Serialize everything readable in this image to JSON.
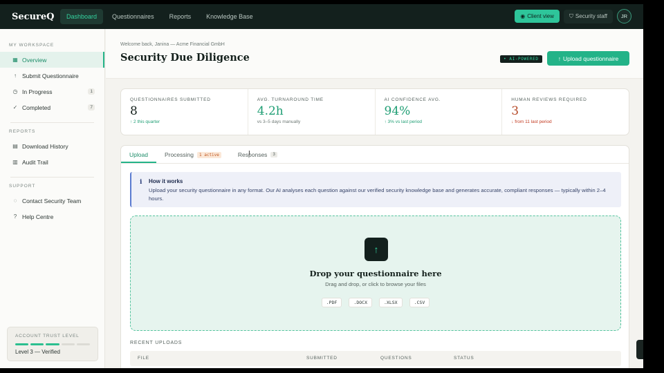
{
  "app": {
    "logo": "SecureQ",
    "nav": [
      {
        "label": "Dashboard",
        "active": true
      },
      {
        "label": "Questionnaires",
        "active": false
      },
      {
        "label": "Reports",
        "active": false
      },
      {
        "label": "Knowledge Base",
        "active": false
      }
    ],
    "client_view_label": "Client view",
    "staff_label": "Security staff",
    "avatar_initials": "JR"
  },
  "sidebar": {
    "workspace_heading": "MY WORKSPACE",
    "workspace_items": [
      {
        "label": "Overview",
        "icon": "grid-icon",
        "badge": ""
      },
      {
        "label": "Submit Questionnaire",
        "icon": "arrow-up-icon",
        "badge": ""
      },
      {
        "label": "In Progress",
        "icon": "clock-icon",
        "badge": "1"
      },
      {
        "label": "Completed",
        "icon": "check-icon",
        "badge": "7"
      }
    ],
    "reports_heading": "REPORTS",
    "reports_items": [
      {
        "label": "Download History",
        "icon": "document-icon"
      },
      {
        "label": "Audit Trail",
        "icon": "clipboard-icon"
      }
    ],
    "support_heading": "SUPPORT",
    "support_items": [
      {
        "label": "Contact Security Team",
        "icon": "chat-icon"
      },
      {
        "label": "Help Centre",
        "icon": "question-icon"
      }
    ],
    "trust": {
      "label": "ACCOUNT TRUST LEVEL",
      "level_filled": 3,
      "level_total": 5,
      "value": "Level 3 — Verified"
    }
  },
  "header": {
    "welcome": "Welcome back, Janina — Acme Financial GmbH",
    "title": "Security Due Diligence",
    "ai_badge": "• AI-POWERED",
    "upload_button": "Upload questionnaire"
  },
  "stats": [
    {
      "label": "QUESTIONNAIRES SUBMITTED",
      "value": "8",
      "note": "↑ 2 this quarter",
      "tone": "default",
      "note_tone": "green"
    },
    {
      "label": "AVG. TURNAROUND TIME",
      "value": "4.2h",
      "note": "vs 3–5 days manually",
      "tone": "green",
      "note_tone": "muted"
    },
    {
      "label": "AI CONFIDENCE AVG.",
      "value": "94%",
      "note": "↑ 3% vs last period",
      "tone": "green",
      "note_tone": "green"
    },
    {
      "label": "HUMAN REVIEWS REQUIRED",
      "value": "3",
      "note": "↓ from 11 last period",
      "tone": "red",
      "note_tone": "red"
    }
  ],
  "tabs": [
    {
      "label": "Upload",
      "active": true,
      "badge": "",
      "count": ""
    },
    {
      "label": "Processing",
      "active": false,
      "badge": "1 active",
      "count": ""
    },
    {
      "label": "Responses",
      "active": false,
      "badge": "",
      "count": "3"
    }
  ],
  "info": {
    "icon": "i",
    "title": "How it works",
    "body": "Upload your security questionnaire in any format. Our AI analyses each question against our verified security knowledge base and generates accurate, compliant responses — typically within 2–4 hours."
  },
  "dropzone": {
    "title": "Drop your questionnaire here",
    "subtitle": "Drag and drop, or click to browse your files",
    "formats": [
      ".PDF",
      ".DOCX",
      ".XLSX",
      ".CSV"
    ]
  },
  "recent": {
    "heading": "RECENT UPLOADS",
    "columns": [
      "FILE",
      "SUBMITTED",
      "QUESTIONS",
      "STATUS"
    ]
  },
  "colors": {
    "accent": "#23b388",
    "topbar": "#13201d",
    "danger": "#b54a28"
  }
}
